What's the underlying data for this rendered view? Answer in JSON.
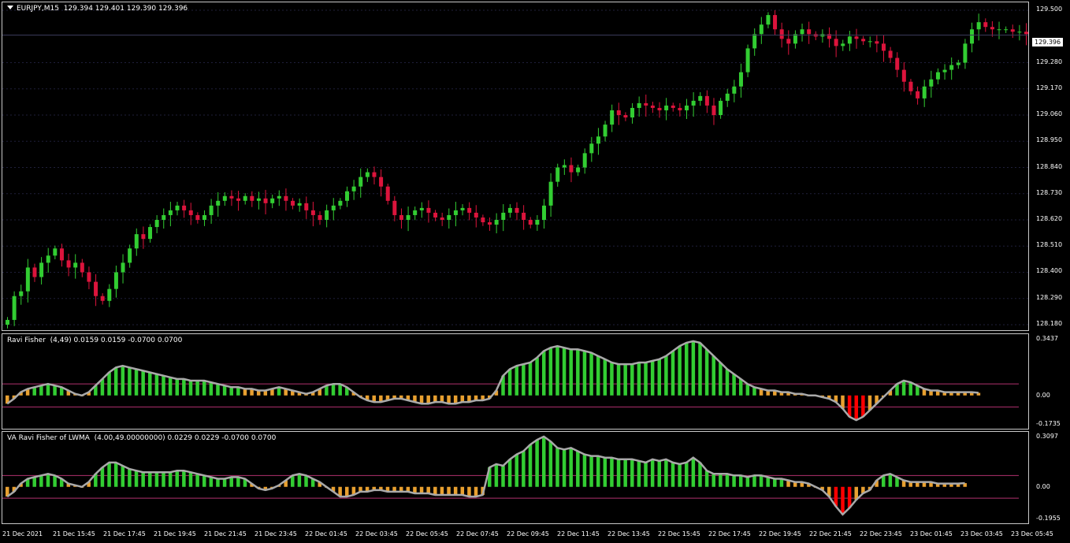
{
  "main": {
    "title": "EURJPY,M15  129.394 129.401 129.390 129.396",
    "current_price": "129.396",
    "y_ticks": [
      "129.500",
      "129.396",
      "129.280",
      "129.170",
      "129.060",
      "128.950",
      "128.840",
      "128.730",
      "128.620",
      "128.510",
      "128.400",
      "128.290",
      "128.180"
    ],
    "colors": {
      "up": "#32cd32",
      "down": "#dc143c",
      "background": "#000000",
      "grid": "#1f1f3a"
    }
  },
  "indicator1": {
    "title": "Ravi Fisher  (4,49) 0.0159 0.0159 -0.0700 0.0700",
    "y_ticks": [
      "0.3437",
      "0.00",
      "-0.1735"
    ]
  },
  "indicator2": {
    "title": "VA Ravi Fisher of LWMA  (4.00,49.00000000) 0.0229 0.0229 -0.0700 0.0700",
    "y_ticks": [
      "0.3097",
      "0.00",
      "-0.1955"
    ]
  },
  "x_ticks": [
    "21 Dec 2021",
    "21 Dec 15:45",
    "21 Dec 17:45",
    "21 Dec 19:45",
    "21 Dec 21:45",
    "21 Dec 23:45",
    "22 Dec 01:45",
    "22 Dec 03:45",
    "22 Dec 05:45",
    "22 Dec 07:45",
    "22 Dec 09:45",
    "22 Dec 11:45",
    "22 Dec 13:45",
    "22 Dec 15:45",
    "22 Dec 17:45",
    "22 Dec 19:45",
    "22 Dec 21:45",
    "22 Dec 23:45",
    "23 Dec 01:45",
    "23 Dec 03:45",
    "23 Dec 05:45"
  ],
  "chart_data": [
    {
      "type": "candlestick",
      "title": "EURJPY,M15",
      "ylim": [
        128.17,
        129.52
      ],
      "close": [
        128.2,
        128.3,
        128.32,
        128.42,
        128.38,
        128.44,
        128.47,
        128.5,
        128.45,
        128.42,
        128.44,
        128.4,
        128.36,
        128.3,
        128.28,
        128.33,
        128.4,
        128.44,
        128.5,
        128.56,
        128.54,
        128.59,
        128.62,
        128.64,
        128.66,
        128.68,
        128.66,
        128.64,
        128.62,
        128.64,
        128.68,
        128.7,
        128.72,
        128.71,
        128.7,
        128.72,
        128.7,
        128.71,
        128.69,
        128.71,
        128.72,
        128.7,
        128.68,
        128.69,
        128.66,
        128.64,
        128.62,
        128.66,
        128.68,
        128.7,
        128.74,
        128.76,
        128.8,
        128.82,
        128.8,
        128.76,
        128.7,
        128.64,
        128.62,
        128.64,
        128.66,
        128.67,
        128.65,
        128.63,
        128.62,
        128.64,
        128.66,
        128.67,
        128.65,
        128.63,
        128.61,
        128.6,
        128.62,
        128.65,
        128.67,
        128.65,
        128.62,
        128.6,
        128.62,
        128.68,
        128.78,
        128.84,
        128.85,
        128.82,
        128.84,
        128.9,
        128.94,
        128.97,
        129.02,
        129.08,
        129.06,
        129.05,
        129.09,
        129.11,
        129.1,
        129.09,
        129.08,
        129.1,
        129.09,
        129.08,
        129.1,
        129.12,
        129.14,
        129.1,
        129.06,
        129.12,
        129.15,
        129.18,
        129.24,
        129.34,
        129.4,
        129.44,
        129.48,
        129.42,
        129.38,
        129.36,
        129.4,
        129.42,
        129.4,
        129.39,
        129.4,
        129.38,
        129.35,
        129.36,
        129.39,
        129.38,
        129.37,
        129.37,
        129.36,
        129.33,
        129.3,
        129.25,
        129.2,
        129.16,
        129.13,
        129.18,
        129.21,
        129.24,
        129.25,
        129.27,
        129.28,
        129.36,
        129.42,
        129.45,
        129.43,
        129.42,
        129.42,
        129.42,
        129.41,
        129.41,
        129.4,
        129.4,
        129.396
      ],
      "source": "approximate reading"
    },
    {
      "type": "histogram+line",
      "title": "Ravi Fisher (4,49)",
      "levels": [
        0.07,
        -0.07
      ],
      "ylim": [
        -0.1735,
        0.3437
      ],
      "values": [
        -0.05,
        -0.02,
        0.02,
        0.04,
        0.05,
        0.06,
        0.07,
        0.06,
        0.05,
        0.03,
        0.01,
        0.0,
        0.02,
        0.06,
        0.1,
        0.14,
        0.17,
        0.18,
        0.17,
        0.16,
        0.15,
        0.14,
        0.13,
        0.12,
        0.11,
        0.1,
        0.1,
        0.09,
        0.09,
        0.09,
        0.08,
        0.07,
        0.06,
        0.05,
        0.05,
        0.04,
        0.04,
        0.03,
        0.03,
        0.04,
        0.05,
        0.04,
        0.03,
        0.02,
        0.01,
        0.02,
        0.04,
        0.06,
        0.07,
        0.07,
        0.05,
        0.02,
        -0.01,
        -0.03,
        -0.04,
        -0.04,
        -0.03,
        -0.02,
        -0.02,
        -0.03,
        -0.04,
        -0.05,
        -0.05,
        -0.04,
        -0.04,
        -0.05,
        -0.05,
        -0.04,
        -0.04,
        -0.03,
        -0.03,
        -0.02,
        0.03,
        0.12,
        0.16,
        0.18,
        0.19,
        0.2,
        0.23,
        0.27,
        0.29,
        0.3,
        0.29,
        0.28,
        0.28,
        0.27,
        0.26,
        0.24,
        0.22,
        0.2,
        0.19,
        0.19,
        0.19,
        0.2,
        0.2,
        0.21,
        0.22,
        0.24,
        0.27,
        0.3,
        0.32,
        0.33,
        0.32,
        0.28,
        0.24,
        0.2,
        0.16,
        0.13,
        0.1,
        0.07,
        0.05,
        0.04,
        0.03,
        0.03,
        0.02,
        0.02,
        0.01,
        0.01,
        0.0,
        0.0,
        -0.01,
        -0.02,
        -0.04,
        -0.08,
        -0.13,
        -0.15,
        -0.13,
        -0.09,
        -0.05,
        -0.01,
        0.03,
        0.07,
        0.09,
        0.08,
        0.06,
        0.04,
        0.03,
        0.03,
        0.02,
        0.02,
        0.02,
        0.02,
        0.02,
        0.016
      ],
      "source": "approximate reading"
    },
    {
      "type": "histogram+line",
      "title": "VA Ravi Fisher of LWMA (4.00,49.00000000)",
      "levels": [
        0.07,
        -0.07
      ],
      "ylim": [
        -0.1955,
        0.3097
      ],
      "values": [
        -0.06,
        -0.03,
        0.02,
        0.05,
        0.06,
        0.07,
        0.08,
        0.07,
        0.05,
        0.02,
        0.01,
        0.0,
        0.03,
        0.08,
        0.12,
        0.15,
        0.15,
        0.13,
        0.11,
        0.1,
        0.09,
        0.09,
        0.09,
        0.09,
        0.09,
        0.1,
        0.1,
        0.09,
        0.08,
        0.07,
        0.06,
        0.05,
        0.05,
        0.06,
        0.06,
        0.05,
        0.02,
        -0.01,
        -0.02,
        -0.01,
        0.01,
        0.04,
        0.07,
        0.08,
        0.07,
        0.05,
        0.03,
        0.0,
        -0.03,
        -0.06,
        -0.06,
        -0.05,
        -0.03,
        -0.03,
        -0.02,
        -0.02,
        -0.03,
        -0.03,
        -0.03,
        -0.03,
        -0.04,
        -0.04,
        -0.04,
        -0.05,
        -0.05,
        -0.05,
        -0.05,
        -0.05,
        -0.06,
        -0.06,
        -0.05,
        0.12,
        0.14,
        0.13,
        0.17,
        0.2,
        0.22,
        0.26,
        0.29,
        0.31,
        0.28,
        0.24,
        0.23,
        0.24,
        0.22,
        0.2,
        0.19,
        0.19,
        0.18,
        0.18,
        0.17,
        0.17,
        0.17,
        0.16,
        0.15,
        0.17,
        0.16,
        0.17,
        0.15,
        0.14,
        0.15,
        0.18,
        0.15,
        0.1,
        0.08,
        0.08,
        0.08,
        0.07,
        0.07,
        0.06,
        0.07,
        0.07,
        0.06,
        0.05,
        0.05,
        0.04,
        0.03,
        0.03,
        0.02,
        0.0,
        -0.02,
        -0.06,
        -0.12,
        -0.17,
        -0.13,
        -0.08,
        -0.04,
        -0.02,
        0.04,
        0.07,
        0.08,
        0.06,
        0.04,
        0.03,
        0.03,
        0.03,
        0.03,
        0.02,
        0.02,
        0.02,
        0.02,
        0.023
      ],
      "source": "approximate reading"
    }
  ]
}
